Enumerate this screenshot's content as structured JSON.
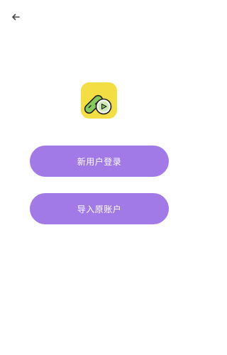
{
  "header": {
    "back_icon": "arrow-left-icon"
  },
  "app": {
    "logo_icon": "cucumber-logo",
    "logo_bg": "#f3df43"
  },
  "actions": {
    "new_user_login_label": "新用户登录",
    "import_account_label": "导入原账户",
    "button_color": "#a27ae8"
  }
}
